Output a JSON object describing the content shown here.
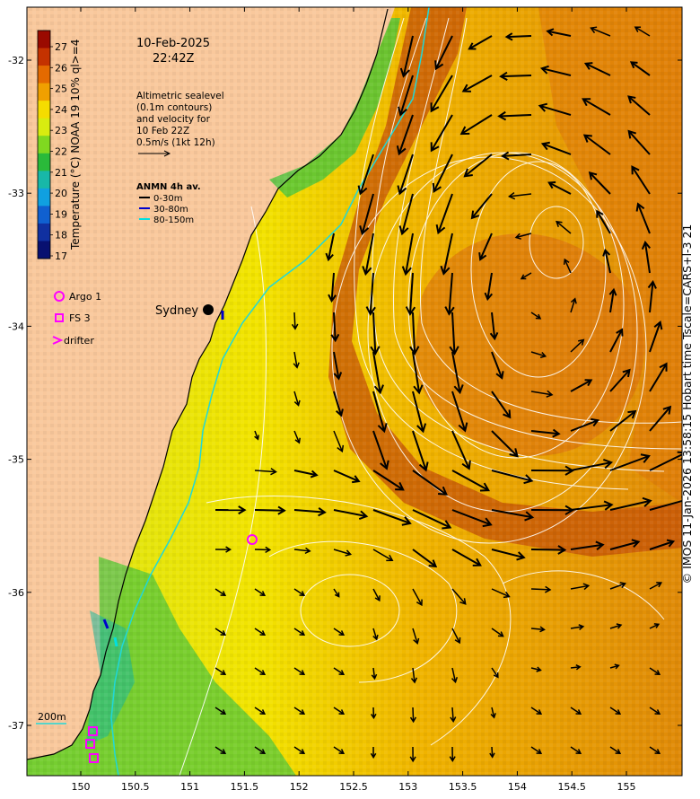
{
  "date": "10-Feb-2025",
  "time": "22:42Z",
  "colorbar": {
    "label": "Temperature (°C) NOAA 19 10% ql>=4",
    "ticks": [
      "27",
      "26",
      "25",
      "24",
      "23",
      "22",
      "21",
      "20",
      "19",
      "18",
      "17"
    ],
    "colors": [
      "#9a0a00",
      "#c43200",
      "#e46a00",
      "#f0a000",
      "#f5dc00",
      "#d8ec10",
      "#80d820",
      "#2aba3a",
      "#18b8a8",
      "#10a0e0",
      "#1060d0",
      "#1030a0",
      "#081070"
    ]
  },
  "altimetry_note": [
    "Altimetric sealevel",
    "(0.1m contours)",
    "and velocity for",
    "10 Feb 22Z",
    "0.5m/s (1kt 12h)"
  ],
  "anmn": {
    "title": "ANMN 4h av.",
    "items": [
      {
        "label": "0-30m",
        "color": "#000000"
      },
      {
        "label": "30-80m",
        "color": "#0000cc"
      },
      {
        "label": "80-150m",
        "color": "#00e0e0"
      }
    ]
  },
  "markers_legend": [
    {
      "label": "Argo 1",
      "symbol": "circle",
      "color": "#ff00ff"
    },
    {
      "label": "FS 3",
      "symbol": "square",
      "color": "#ff00ff"
    },
    {
      "label": "drifter",
      "symbol": "chevron",
      "color": "#ff00ff"
    }
  ],
  "city": "Sydney",
  "isobath_label": "200m",
  "axes": {
    "lat_ticks": [
      -32,
      -33,
      -34,
      -35,
      -36,
      -37
    ],
    "lat_labels": [
      "-32",
      "-33",
      "-34",
      "-35",
      "-36",
      "-37"
    ],
    "lon_ticks": [
      150,
      150.5,
      151,
      151.5,
      152,
      152.5,
      153,
      153.5,
      154,
      154.5,
      155
    ],
    "lon_labels": [
      "150",
      "150.5",
      "151",
      "151.5",
      "152",
      "152.5",
      "153",
      "153.5",
      "154",
      "154.5",
      "155"
    ]
  },
  "credit": "© IMOS 11-Jan-2026 13:58:15 Hobart time Tscale=CARS+l-3 21"
}
